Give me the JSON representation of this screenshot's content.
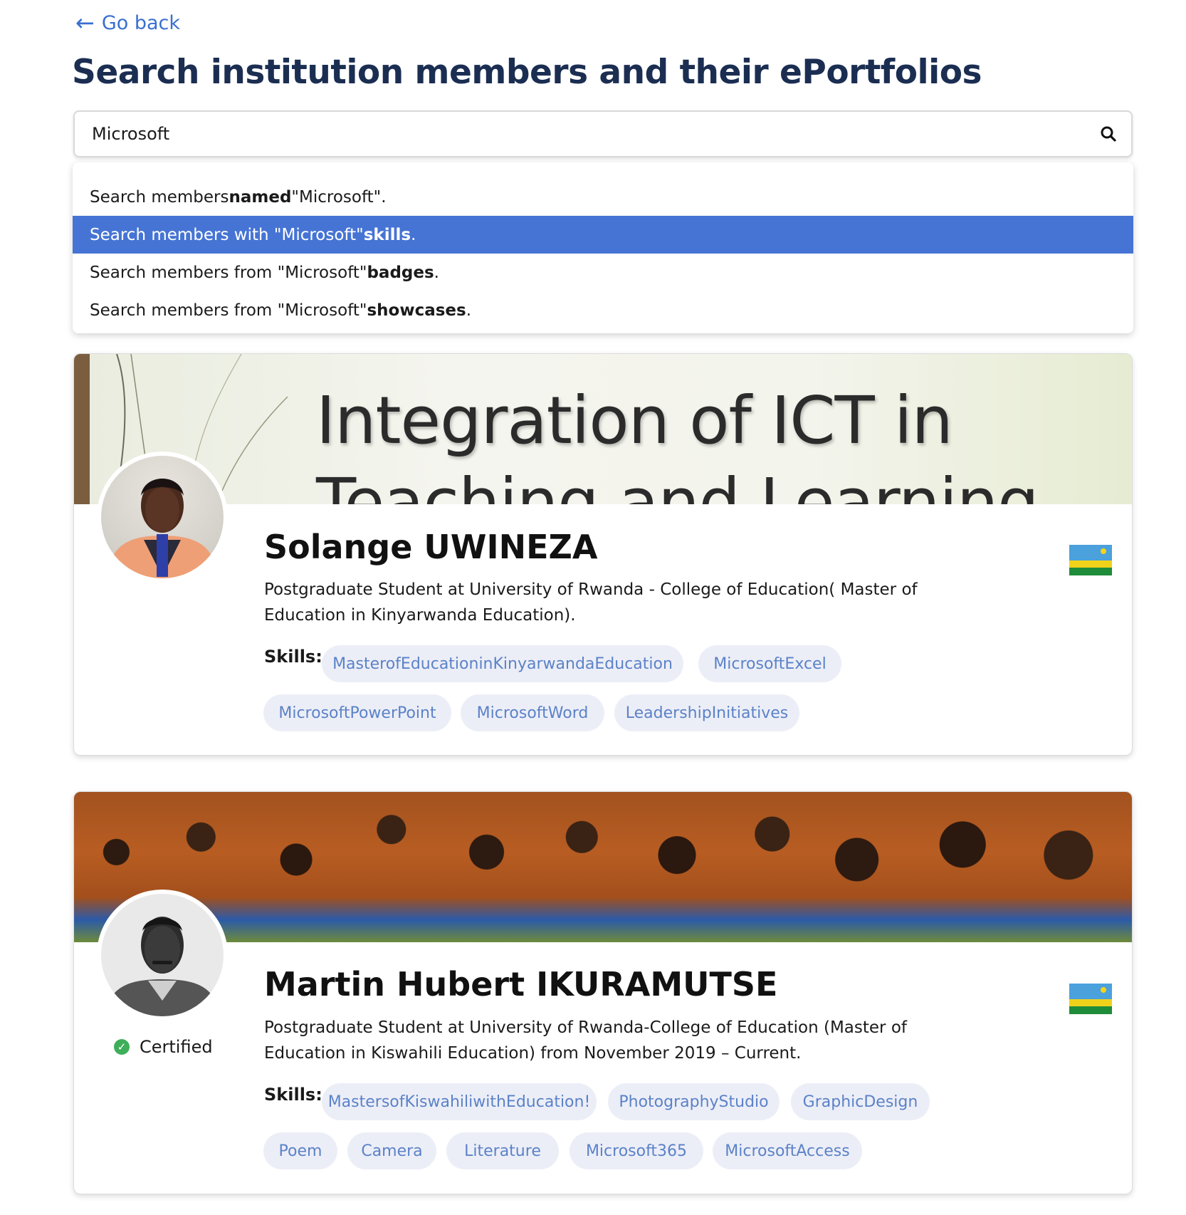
{
  "nav": {
    "back_label": "Go back"
  },
  "page": {
    "title": "Search institution members and their ePortfolios"
  },
  "search": {
    "value": "Microsoft"
  },
  "dropdown": {
    "options": [
      {
        "prefix": "Search members ",
        "keyword": "named",
        "suffix": " \"Microsoft\".",
        "active": false
      },
      {
        "prefix": "Search members with \"Microsoft\" ",
        "keyword": "skills",
        "suffix": ".",
        "active": true
      },
      {
        "prefix": "Search members from \"Microsoft\" ",
        "keyword": "badges",
        "suffix": ".",
        "active": false
      },
      {
        "prefix": "Search members from \"Microsoft\" ",
        "keyword": "showcases",
        "suffix": ".",
        "active": false
      }
    ]
  },
  "members": [
    {
      "banner_text_line1": "Integration of ICT in",
      "banner_text_line2": "Teaching and Learning",
      "name": "Solange UWINEZA",
      "headline": "Postgraduate Student at University of Rwanda - College of Education( Master of Education in Kinyarwanda Education).",
      "skills_label": "Skills:",
      "skills": [
        "MasterofEducationinKinyarwandaEducation",
        "MicrosoftExcel",
        "MicrosoftPowerPoint",
        "MicrosoftWord",
        "LeadershipInitiatives"
      ],
      "flag": "rwanda-flag"
    },
    {
      "name": "Martin Hubert IKURAMUTSE",
      "certified_label": "Certified",
      "headline": "Postgraduate Student at University of Rwanda-College of Education (Master of Education in Kiswahili Education) from November 2019 – Current.",
      "skills_label": "Skills:",
      "skills": [
        "MastersofKiswahiliwithEducation!",
        "PhotographyStudio",
        "GraphicDesign",
        "Poem",
        "Camera",
        "Literature",
        "Microsoft365",
        "MicrosoftAccess"
      ],
      "flag": "rwanda-flag"
    }
  ],
  "colors": {
    "accent": "#4674d4",
    "title": "#1b2e52",
    "tag_bg": "#eceef7",
    "tag_text": "#5b82c8",
    "certified": "#3fae5a"
  }
}
